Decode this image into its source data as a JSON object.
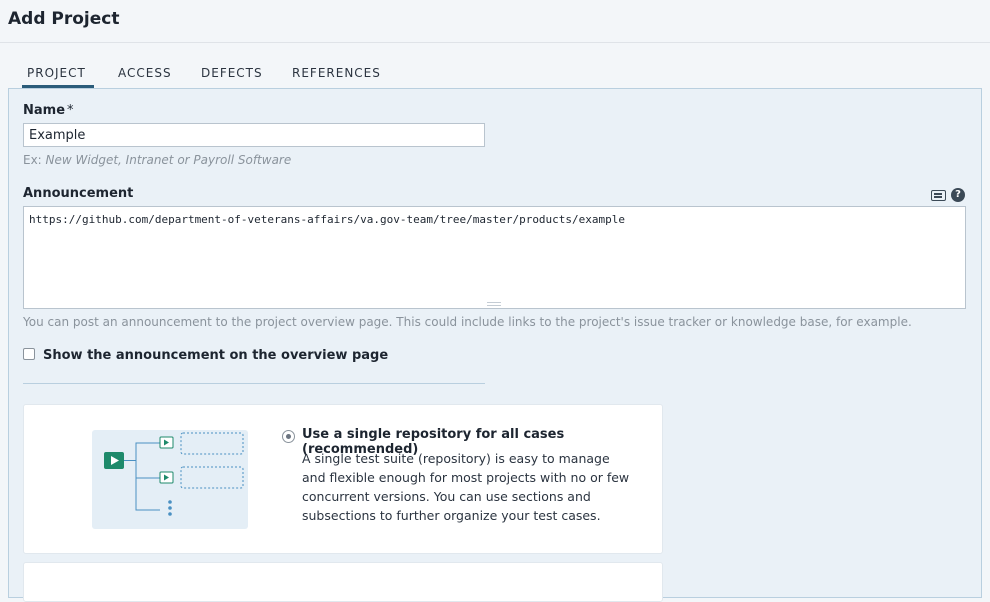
{
  "page": {
    "title": "Add Project"
  },
  "tabs": [
    {
      "label": "PROJECT",
      "active": true
    },
    {
      "label": "ACCESS",
      "active": false
    },
    {
      "label": "DEFECTS",
      "active": false
    },
    {
      "label": "REFERENCES",
      "active": false
    }
  ],
  "form": {
    "name_label": "Name",
    "name_required": "*",
    "name_value": "Example",
    "name_hint_prefix": "Ex: ",
    "name_hint_example": "New Widget, Intranet or Payroll Software",
    "announcement_label": "Announcement",
    "announcement_value": "https://github.com/department-of-veterans-affairs/va.gov-team/tree/master/products/example",
    "announcement_hint": "You can post an announcement to the project overview page. This could include links to the project's issue tracker or knowledge base, for example.",
    "show_announcement_label": "Show the announcement on the overview page",
    "show_announcement_checked": false
  },
  "repository_options": [
    {
      "title": "Use a single repository for all cases (recommended)",
      "description": "A single test suite (repository) is easy to manage and flexible enough for most projects with no or few concurrent versions. You can use sections and subsections to further organize your test cases.",
      "selected": true
    }
  ],
  "colors": {
    "accent": "#2b5c7a",
    "illustration_green": "#1e8a6b",
    "illustration_blue": "#4a90c2"
  },
  "icons": {
    "keyboard": "keyboard-icon",
    "help": "help-icon"
  },
  "help_glyph": "?"
}
